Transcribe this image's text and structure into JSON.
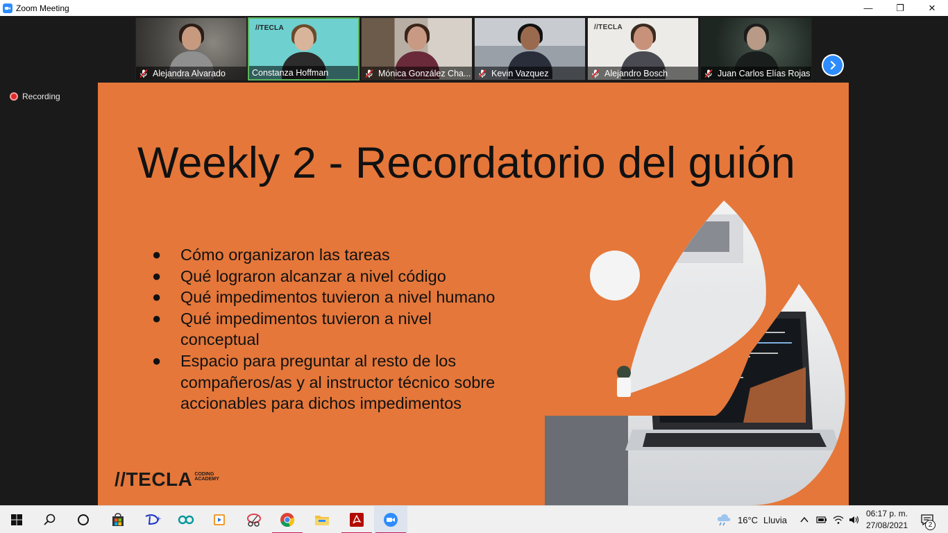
{
  "window": {
    "title": "Zoom Meeting",
    "minimize_glyph": "—",
    "restore_glyph": "❐",
    "close_glyph": "✕"
  },
  "gallery": {
    "participants": [
      {
        "name": "Alejandra Alvarado",
        "muted": true,
        "active": false
      },
      {
        "name": "Constanza Hoffman",
        "muted": false,
        "active": true,
        "background_label": "//TECLA"
      },
      {
        "name": "Mónica González Cha...",
        "muted": true,
        "active": false
      },
      {
        "name": "Kevin Vazquez",
        "muted": true,
        "active": false
      },
      {
        "name": "Alejandro Bosch",
        "muted": true,
        "active": false,
        "background_label": "//TECLA"
      },
      {
        "name": "Juan Carlos Elías Rojas",
        "muted": true,
        "active": false
      }
    ],
    "next_icon": "chevron-right-icon"
  },
  "recording": {
    "label": "Recording"
  },
  "slide": {
    "title": "Weekly 2 - Recordatorio del guión",
    "bullet_glyph": "●",
    "bullets": [
      "Cómo organizaron las tareas",
      "Qué lograron alcanzar a nivel código",
      "Qué impedimentos tuvieron a nivel humano",
      "Qué impedimentos tuvieron a nivel conceptual",
      "Espacio para preguntar al resto de los compañeros/as y al instructor técnico sobre accionables para dichos impedimentos"
    ],
    "logo": {
      "main": "//TECLA",
      "sub_line1": "CODING",
      "sub_line2": "ACADEMY"
    },
    "background_color": "#e5773a"
  },
  "taskbar": {
    "apps": [
      "start-icon",
      "search-icon",
      "cortana-icon",
      "store-icon",
      "disney-plus-icon",
      "arduino-icon",
      "media-player-icon",
      "snipping-tool-icon",
      "chrome-icon",
      "file-explorer-icon",
      "acrobat-icon",
      "zoom-icon"
    ],
    "weather": {
      "temperature": "16°C",
      "condition": "Lluvia"
    },
    "clock": {
      "time": "06:17 p. m.",
      "date": "27/08/2021"
    },
    "notifications_count": "2"
  }
}
